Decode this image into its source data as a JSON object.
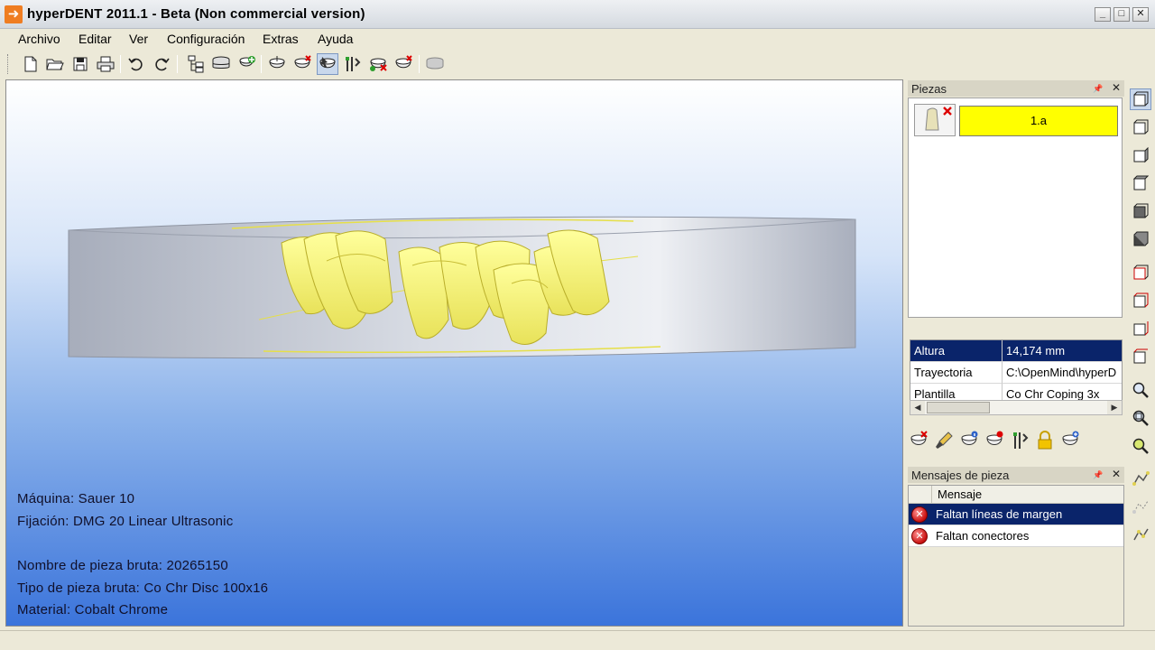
{
  "window": {
    "title": "hyperDENT 2011.1 - Beta (Non commercial version)",
    "app_icon": "arrow-icon",
    "controls": [
      "minimize",
      "maximize",
      "close"
    ]
  },
  "menu": {
    "items": [
      "Archivo",
      "Editar",
      "Ver",
      "Configuración",
      "Extras",
      "Ayuda"
    ]
  },
  "toolbar": {
    "buttons": [
      "new-file-icon",
      "open-folder-icon",
      "save-icon",
      "print-icon",
      "undo-icon",
      "redo-icon",
      "tree-icon",
      "stack-disc-icon",
      "add-part-icon",
      "part-icon",
      "remove-part-icon",
      "select-part-icon",
      "tools-icon",
      "delete-part-icon",
      "part-settings-icon",
      "disc-icon"
    ]
  },
  "viewport": {
    "info_lines": [
      "Máquina: Sauer 10",
      "Fijación: DMG 20 Linear Ultrasonic",
      "Nombre de pieza bruta: 20265150",
      "Tipo de pieza bruta: Co Chr Disc 100x16",
      "Material: Cobalt Chrome"
    ],
    "colors": {
      "tooth": "#ffff7a",
      "disc": "#b0b6c3",
      "bg_top": "#ffffff",
      "bg_bottom": "#3b74db"
    }
  },
  "pieces_panel": {
    "title": "Piezas",
    "pin": "📌",
    "close": "✕",
    "items": [
      {
        "label": "1.a",
        "color": "#ffff00"
      }
    ]
  },
  "properties": {
    "rows": [
      {
        "name": "Altura",
        "value": "14,174 mm",
        "selected": true
      },
      {
        "name": "Trayectoria",
        "value": "C:\\OpenMind\\hyperD",
        "selected": false
      },
      {
        "name": "Plantilla",
        "value": "Co Chr Coping 3x",
        "selected": false
      }
    ]
  },
  "piece_tools": [
    "remove-icon",
    "brush-icon",
    "info-icon",
    "status-icon",
    "tools-icon",
    "lock-icon",
    "add-icon"
  ],
  "messages_panel": {
    "title": "Mensajes de pieza",
    "pin": "📌",
    "close": "✕",
    "column": "Mensaje",
    "rows": [
      {
        "text": "Faltan líneas de margen",
        "selected": true
      },
      {
        "text": "Faltan conectores",
        "selected": false
      }
    ]
  },
  "vertical_toolbar": [
    "view-front-icon",
    "view-back-icon",
    "view-left-icon",
    "view-right-icon",
    "view-top-icon",
    "view-bottom-icon",
    "view-iso-1-icon",
    "view-iso-2-icon",
    "view-iso-3-icon",
    "view-iso-4-icon",
    "zoom-icon",
    "zoom-fit-icon",
    "zoom-window-icon",
    "measure-icon",
    "measure-2-icon",
    "measure-3-icon"
  ]
}
